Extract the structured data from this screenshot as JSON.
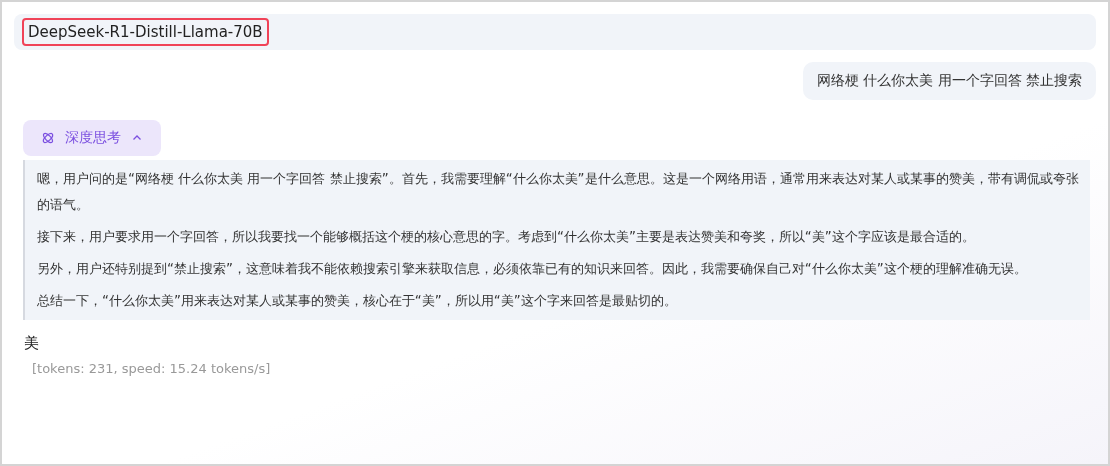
{
  "model": {
    "name": "DeepSeek-R1-Distill-Llama-70B",
    "highlighted": true
  },
  "user_message": "网络梗 什么你太美 用一个字回答 禁止搜索",
  "thinking": {
    "label": "深度思考",
    "expanded": true,
    "paragraphs": [
      "嗯，用户问的是“网络梗 什么你太美 用一个字回答 禁止搜索”。首先，我需要理解“什么你太美”是什么意思。这是一个网络用语，通常用来表达对某人或某事的赞美，带有调侃或夸张的语气。",
      "接下来，用户要求用一个字回答，所以我要找一个能够概括这个梗的核心意思的字。考虑到“什么你太美”主要是表达赞美和夸奖，所以“美”这个字应该是最合适的。",
      "另外，用户还特别提到“禁止搜索”，这意味着我不能依赖搜索引擎来获取信息，必须依靠已有的知识来回答。因此，我需要确保自己对“什么你太美”这个梗的理解准确无误。",
      "总结一下，“什么你太美”用来表达对某人或某事的赞美，核心在于“美”，所以用“美”这个字来回答是最贴切的。"
    ]
  },
  "answer": "美",
  "stats": "[tokens: 231, speed: 15.24 tokens/s]"
}
